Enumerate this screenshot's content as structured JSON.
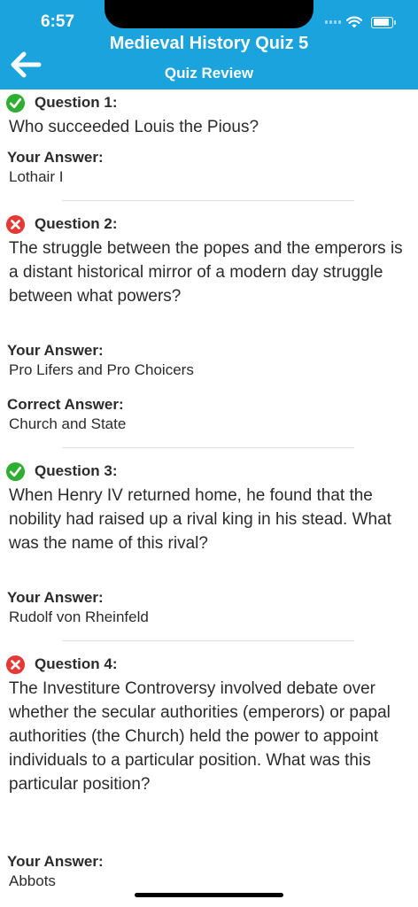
{
  "status_bar": {
    "time": "6:57"
  },
  "nav": {
    "title": "Medieval History Quiz 5",
    "subtitle": "Quiz Review",
    "back_icon": "back-arrow-icon"
  },
  "labels": {
    "your_answer": "Your Answer:",
    "correct_answer": "Correct Answer:"
  },
  "questions": [
    {
      "label": "Question 1:",
      "status": "correct",
      "text": "Who succeeded Louis the Pious?",
      "your_answer": "Lothair I"
    },
    {
      "label": "Question 2:",
      "status": "incorrect",
      "text": "The struggle between the popes and the emperors is a distant historical mirror of a modern day struggle between what powers?",
      "your_answer": "Pro Lifers and Pro Choicers",
      "correct_answer": "Church and State"
    },
    {
      "label": "Question 3:",
      "status": "correct",
      "text": "When Henry IV returned home, he found that the nobility had raised up a rival king in his stead. What was the name of this rival?",
      "your_answer": "Rudolf von Rheinfeld"
    },
    {
      "label": "Question 4:",
      "status": "incorrect",
      "text": "The Investiture Controversy involved debate over whether the secular authorities (emperors) or papal authorities (the Church) held the power to appoint individuals to a particular position. What was this particular position?",
      "your_answer": "Abbots"
    }
  ],
  "colors": {
    "header": "#1ba3dd",
    "correct": "#2fae2f",
    "incorrect": "#e53935"
  }
}
